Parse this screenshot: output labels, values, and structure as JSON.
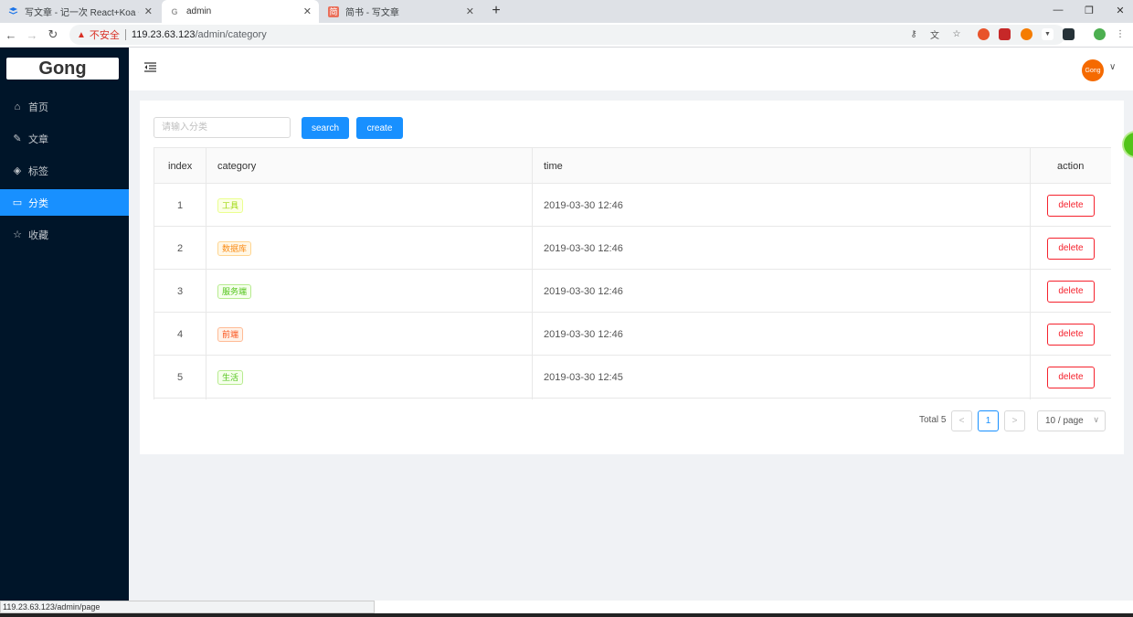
{
  "browser": {
    "tabs": [
      {
        "title": "写文章 - 记一次 React+Koa + M",
        "favicon": "layers-icon"
      },
      {
        "title": "admin",
        "favicon": "google-icon"
      },
      {
        "title": "简书 - 写文章",
        "favicon": "jianshu-icon",
        "favicon_text": "简"
      }
    ],
    "insecure_label": "不安全",
    "url_host": "119.23.63.123",
    "url_path": "/admin/category",
    "status_url": "119.23.63.123/admin/page"
  },
  "sidebar": {
    "logo": "Gong",
    "items": [
      {
        "label": "首页",
        "icon": "home-icon",
        "selected": false
      },
      {
        "label": "文章",
        "icon": "edit-icon",
        "selected": false
      },
      {
        "label": "标签",
        "icon": "tag-icon",
        "selected": false
      },
      {
        "label": "分类",
        "icon": "folder-icon",
        "selected": true
      },
      {
        "label": "收藏",
        "icon": "star-icon",
        "selected": false
      }
    ]
  },
  "header": {
    "avatar_text": "Gong",
    "avatar_color": "#f56a00"
  },
  "toolbar": {
    "search_placeholder": "请输入分类",
    "search_label": "search",
    "create_label": "create"
  },
  "table": {
    "columns": [
      "index",
      "category",
      "time",
      "action"
    ],
    "rows": [
      {
        "index": "1",
        "category": "工具",
        "time": "2019-03-30 12:46",
        "action": "delete"
      },
      {
        "index": "2",
        "category": "数据库",
        "time": "2019-03-30 12:46",
        "action": "delete"
      },
      {
        "index": "3",
        "category": "服务端",
        "time": "2019-03-30 12:46",
        "action": "delete"
      },
      {
        "index": "4",
        "category": "前端",
        "time": "2019-03-30 12:46",
        "action": "delete"
      },
      {
        "index": "5",
        "category": "生活",
        "time": "2019-03-30 12:45",
        "action": "delete"
      }
    ]
  },
  "pagination": {
    "total_text": "Total 5",
    "current_page": "1",
    "page_size": "10 / page"
  },
  "colors": {
    "primary": "#1890ff",
    "sidebar_bg": "#001529",
    "danger": "#f5222d"
  }
}
